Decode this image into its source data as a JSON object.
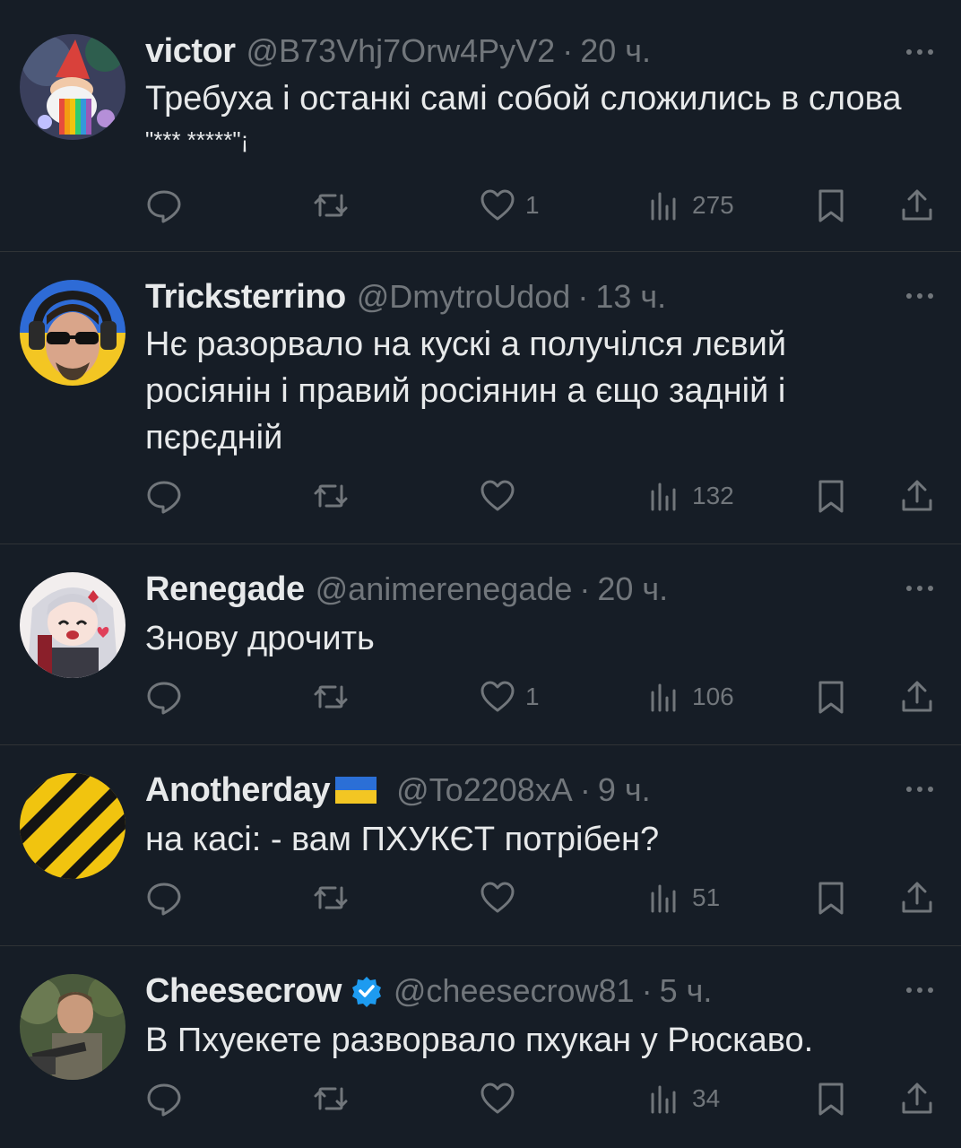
{
  "tweets": [
    {
      "name": "victor",
      "handle": "@B73Vhj7Orw4PyV2",
      "dot": "·",
      "time": "20 ч.",
      "text_lines": [
        "Требуха і останкі самі собой сложились в слова",
        "\"*** *****\"¡"
      ],
      "likes": "1",
      "views": "275",
      "flag": false,
      "verified": false,
      "avatar": "gnome-rainbow-avatar"
    },
    {
      "name": "Tricksterrino",
      "handle": "@DmytroUdod",
      "dot": "·",
      "time": "13 ч.",
      "text_lines": [
        "Нє разорвало на кускі а получілся лєвий",
        "росіянін і правий росіянин а єщо задній і",
        "пєрєдній"
      ],
      "likes": "",
      "views": "132",
      "flag": false,
      "verified": false,
      "avatar": "man-sunglasses-avatar"
    },
    {
      "name": "Renegade",
      "handle": "@animerenegade",
      "dot": "·",
      "time": "20 ч.",
      "text_lines": [
        "Знову дрочить"
      ],
      "likes": "1",
      "views": "106",
      "flag": false,
      "verified": false,
      "avatar": "anime-girl-avatar"
    },
    {
      "name": "Anotherday",
      "handle": "@To2208xA",
      "dot": "·",
      "time": "9 ч.",
      "text_lines": [
        "на касі: - вам ПХУКЄТ потрібен?"
      ],
      "likes": "",
      "views": "51",
      "flag": true,
      "verified": false,
      "avatar": "hazard-stripes-avatar"
    },
    {
      "name": "Cheesecrow",
      "handle": "@cheesecrow81",
      "dot": "·",
      "time": "5 ч.",
      "text_lines": [
        "В Пхуекете разворвало пхукан у Рюскаво."
      ],
      "likes": "",
      "views": "34",
      "flag": false,
      "verified": true,
      "avatar": "soldier-photo-avatar"
    }
  ],
  "colors": {
    "background": "#161d26",
    "text": "#e7e9ea",
    "muted": "#71767b",
    "verified_blue": "#1d9bf0"
  }
}
